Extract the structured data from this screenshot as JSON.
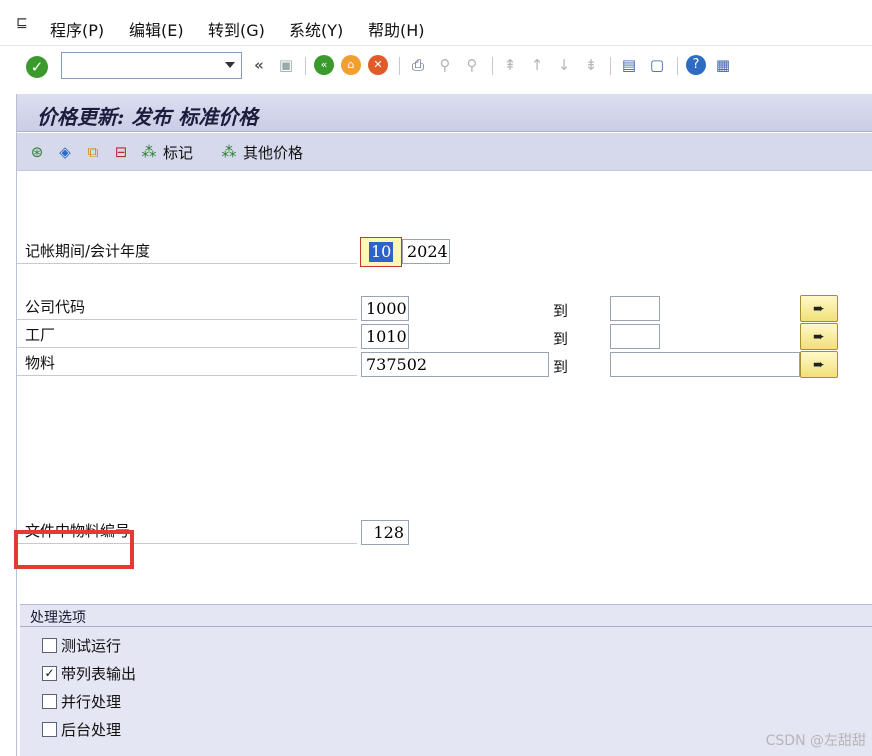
{
  "menu": {
    "items": [
      "程序(P)",
      "编辑(E)",
      "转到(G)",
      "系统(Y)",
      "帮助(H)"
    ]
  },
  "toolbar": {
    "command_value": "",
    "back_glyph": "«"
  },
  "screen": {
    "title": "价格更新: 发布 标准价格",
    "app_buttons": {
      "mark_label": "标记",
      "other_prices_label": "其他价格"
    }
  },
  "form": {
    "period_label": "记帐期间/会计年度",
    "period_value": "10",
    "fiscal_year_value": "2024",
    "company_code_label": "公司代码",
    "company_code_value": "1000",
    "plant_label": "工厂",
    "plant_value": "1010",
    "material_label": "物料",
    "material_value": "737502",
    "to_label": "到",
    "materials_per_file_label": "文件中物料编号",
    "materials_per_file_value": "128"
  },
  "processing": {
    "title": "处理选项",
    "options": [
      {
        "label": "测试运行",
        "checked": false
      },
      {
        "label": "带列表输出",
        "checked": true
      },
      {
        "label": "并行处理",
        "checked": false
      },
      {
        "label": "后台处理",
        "checked": false
      }
    ]
  },
  "watermark": "CSDN @左甜甜",
  "colors": {
    "title_bar": "#c9cde6",
    "app_toolbar": "#d6d9ec",
    "highlight": "#e53935"
  }
}
